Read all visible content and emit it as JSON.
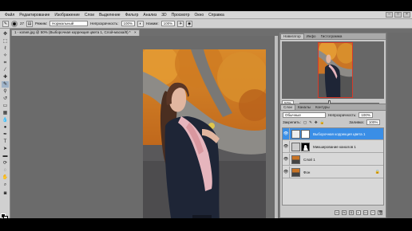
{
  "menu": {
    "items": [
      "Файл",
      "Редактирование",
      "Изображение",
      "Слои",
      "Выделение",
      "Фильтр",
      "Анализ",
      "3D",
      "Просмотр",
      "Окно",
      "Справка"
    ],
    "window_controls": [
      "–",
      "□",
      "×"
    ]
  },
  "options": {
    "brush_size": "27",
    "mode_label": "Режим:",
    "mode_value": "Нормальный",
    "opacity_label": "Непрозрачность:",
    "opacity_value": "100%",
    "flow_label": "Нажим:",
    "flow_value": "100%"
  },
  "document": {
    "tab_title": "1 - копия.jpg @ 50% (Выборочная коррекция цвета 1, Слой-маска/8) *",
    "tab_close": "×"
  },
  "navigator": {
    "tabs": [
      "Навигатор",
      "Инфо",
      "Гистограмма"
    ],
    "zoom": "50%"
  },
  "layers_panel": {
    "tabs": [
      "Слои",
      "Каналы",
      "Контуры"
    ],
    "blend_mode": "Обычные",
    "opacity_label": "Непрозрачность:",
    "opacity_value": "100%",
    "lock_label": "Закрепить:",
    "fill_label": "Заливка:",
    "fill_value": "100%",
    "layers": [
      {
        "name": "Выборочная коррекция цвета 1",
        "selected": true
      },
      {
        "name": "Микширование каналов 1",
        "selected": false
      },
      {
        "name": "Слой 1",
        "selected": false
      },
      {
        "name": "Фон",
        "selected": false,
        "locked": true
      }
    ]
  },
  "colors": {
    "accent": "#3a8ee6",
    "chrome": "#d0d0d0",
    "workspace": "#6b6b6b"
  }
}
